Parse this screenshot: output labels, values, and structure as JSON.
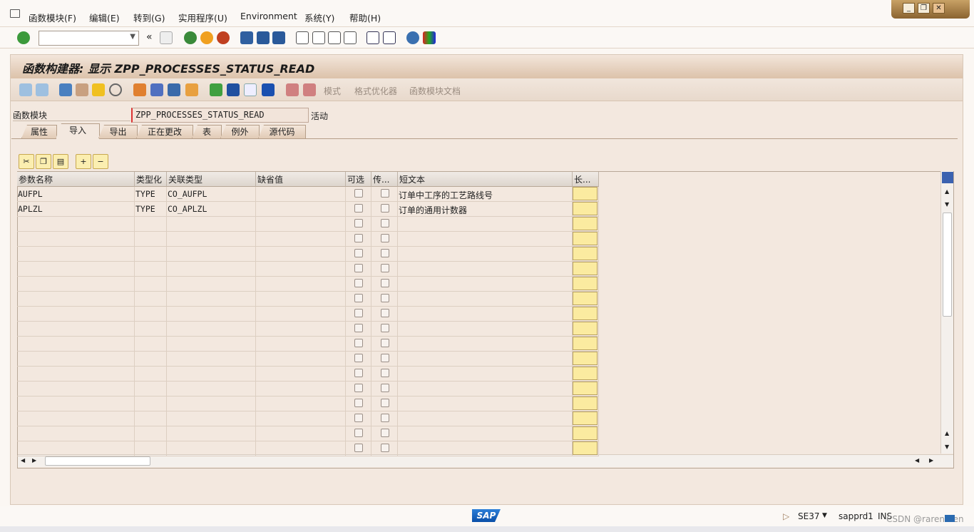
{
  "menu": {
    "items": [
      "函数模块(F)",
      "编辑(E)",
      "转到(G)",
      "实用程序(U)",
      "Environment",
      "系统(Y)",
      "帮助(H)"
    ]
  },
  "window_controls": {
    "minimize": "_",
    "restore": "❐",
    "close": "✕"
  },
  "command_field": {
    "value": "",
    "placeholder": ""
  },
  "title": "函数构建器: 显示 ZPP_PROCESSES_STATUS_READ",
  "app_toolbar": {
    "pattern": "模式",
    "pretty_printer": "格式优化器",
    "fm_doc": "函数模块文档"
  },
  "function_module": {
    "label": "函数模块",
    "value": "ZPP_PROCESSES_STATUS_READ",
    "status": "活动"
  },
  "tabs": [
    "属性",
    "导入",
    "导出",
    "正在更改",
    "表",
    "例外",
    "源代码"
  ],
  "active_tab": 1,
  "grid": {
    "columns": [
      "参数名称",
      "类型化",
      "关联类型",
      "缺省值",
      "可选",
      "传...",
      "短文本",
      "长..."
    ],
    "rows": [
      {
        "name": "AUFPL",
        "typing": "TYPE",
        "ref_type": "CO_AUFPL",
        "default": "",
        "optional": false,
        "pass_value": false,
        "short_text": "订单中工序的工艺路线号"
      },
      {
        "name": "APLZL",
        "typing": "TYPE",
        "ref_type": "CO_APLZL",
        "default": "",
        "optional": false,
        "pass_value": false,
        "short_text": "订单的通用计数器"
      }
    ],
    "empty_rows": 16
  },
  "status": {
    "tcode": "SE37",
    "server": "sapprd1",
    "mode": "INS",
    "watermark": "CSDN @rarenmen",
    "logo": "SAP"
  }
}
